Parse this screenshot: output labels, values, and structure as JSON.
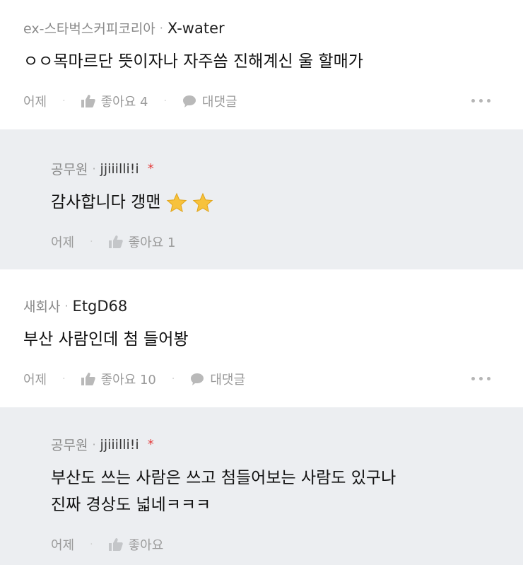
{
  "comments": [
    {
      "company": "ex-스타벅스커피코리아",
      "nickname": "X-water",
      "text": "ㅇㅇ목마르단 뜻이자나 자주씀 진해계신 울 할매가",
      "time": "어제",
      "like_label": "좋아요 4",
      "reply_label": "대댓글"
    },
    {
      "company": "공무원",
      "nickname": "jjiiilli!i",
      "author_mark": "*",
      "text": "감사합니다 갱맨",
      "time": "어제",
      "like_label": "좋아요 1"
    },
    {
      "company": "새회사",
      "nickname": "EtgD68",
      "text": "부산 사람인데 첨 들어봥",
      "time": "어제",
      "like_label": "좋아요 10",
      "reply_label": "대댓글"
    },
    {
      "company": "공무원",
      "nickname": "jjiiilli!i",
      "author_mark": "*",
      "text_line1": "부산도 쓰는 사람은 쓰고 첨들어보는 사람도 있구나",
      "text_line2": "진짜 경상도 넓네ㅋㅋㅋ",
      "time": "어제",
      "like_label": "좋아요"
    }
  ],
  "meta_separator": "·",
  "action_separator": "·",
  "colors": {
    "reply_bg": "#eceef1",
    "author_mark": "#e33a3a",
    "star": "#f7c23c"
  },
  "icons": [
    "thumbs-up-icon",
    "speech-bubble-icon",
    "more-dots-icon",
    "star-icon"
  ]
}
